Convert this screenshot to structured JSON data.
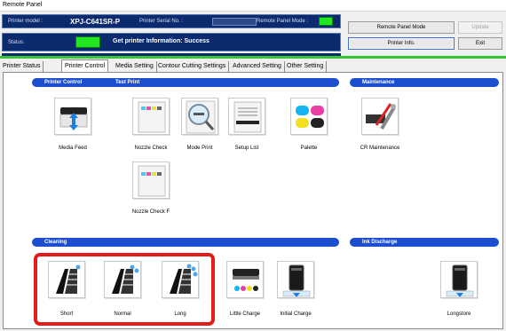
{
  "window": {
    "title": "Remote Panel"
  },
  "header": {
    "printer_model_label": "Printer model :",
    "printer_model_value": "XPJ-C641SR-P",
    "serial_label": "Printer Serial No. :",
    "remote_mode_label": "Remote Panel Mode :",
    "status_label": "Status:",
    "status_value": "Get printer Information: Success",
    "indicator_color": "#22e622"
  },
  "buttons": {
    "remote_panel_mode": "Remote Panel Mode",
    "update": "Update",
    "printer_info": "Printer Info.",
    "exit": "Exit"
  },
  "tabs": [
    {
      "label": "Printer Status"
    },
    {
      "label": "Printer Control",
      "active": true
    },
    {
      "label": "Media Setting"
    },
    {
      "label": "Contour Cutting Settings"
    },
    {
      "label": "Advanced Setting"
    },
    {
      "label": "Other Setting"
    }
  ],
  "sections": {
    "printer_control": "Printer Control",
    "test_print": "Test Print",
    "maintenance": "Maintenance",
    "cleaning": "Cleaning",
    "ink_discharge": "Ink Discharge"
  },
  "items": {
    "media_feed": "Media Feed",
    "nozzle_check": "Nozzle Check",
    "mode_print": "Mode Print",
    "setup_list": "Setup List",
    "palette": "Palette",
    "cr_maintenance": "CR Maintenance",
    "nozzle_check_f": "Nozzle Check F",
    "short": "Short",
    "normal": "Normal",
    "long": "Long",
    "little_charge": "Little Charge",
    "initial_charge": "Initial Charge",
    "longstore": "Longstore"
  },
  "colors": {
    "section_blue": "#1c4fd0",
    "header_navy": "#0c2a6e",
    "highlight_red": "#e31b1b"
  }
}
